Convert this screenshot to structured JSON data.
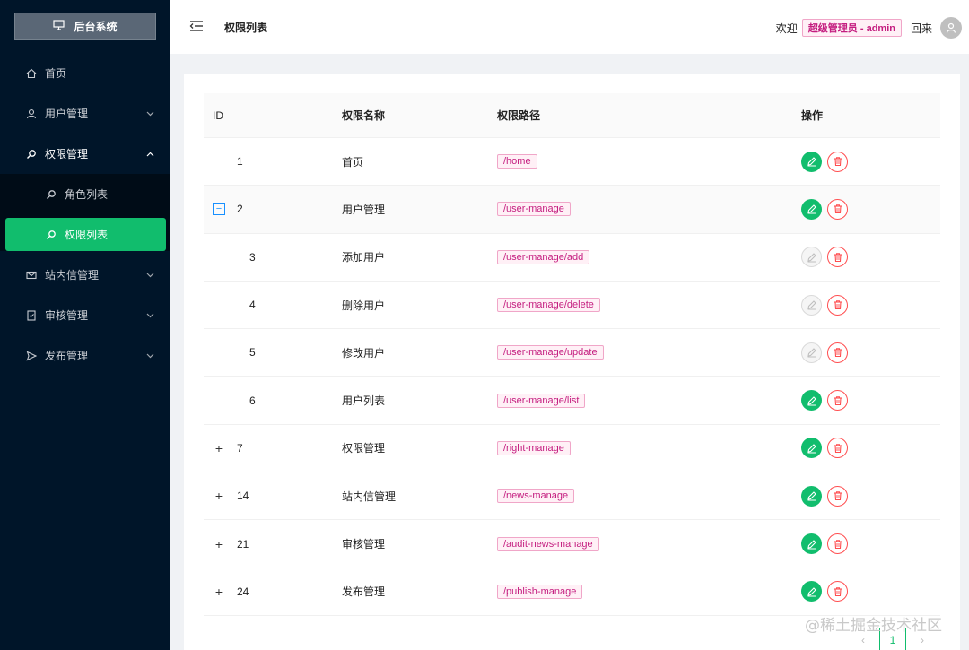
{
  "app": {
    "logo_title": "后台系统"
  },
  "sidebar": {
    "items": [
      {
        "label": "首页",
        "icon": "home-icon"
      },
      {
        "label": "用户管理",
        "icon": "user-icon"
      },
      {
        "label": "权限管理",
        "icon": "search-icon",
        "open": true,
        "children": [
          {
            "label": "角色列表",
            "icon": "search-icon"
          },
          {
            "label": "权限列表",
            "icon": "search-icon",
            "active": true
          }
        ]
      },
      {
        "label": "站内信管理",
        "icon": "mail-icon"
      },
      {
        "label": "审核管理",
        "icon": "audit-icon"
      },
      {
        "label": "发布管理",
        "icon": "send-icon"
      }
    ]
  },
  "header": {
    "title": "权限列表",
    "welcome": "欢迎",
    "role": "超级管理员 - admin",
    "back": "回来"
  },
  "table": {
    "columns": [
      "ID",
      "权限名称",
      "权限路径",
      "操作"
    ],
    "rows": [
      {
        "id": "1",
        "name": "首页",
        "path": "/home",
        "expander": "",
        "child": false,
        "edit_disabled": false
      },
      {
        "id": "2",
        "name": "用户管理",
        "path": "/user-manage",
        "expander": "minus",
        "child": false,
        "edit_disabled": false
      },
      {
        "id": "3",
        "name": "添加用户",
        "path": "/user-manage/add",
        "expander": "",
        "child": true,
        "edit_disabled": true
      },
      {
        "id": "4",
        "name": "删除用户",
        "path": "/user-manage/delete",
        "expander": "",
        "child": true,
        "edit_disabled": true
      },
      {
        "id": "5",
        "name": "修改用户",
        "path": "/user-manage/update",
        "expander": "",
        "child": true,
        "edit_disabled": true
      },
      {
        "id": "6",
        "name": "用户列表",
        "path": "/user-manage/list",
        "expander": "",
        "child": true,
        "edit_disabled": false
      },
      {
        "id": "7",
        "name": "权限管理",
        "path": "/right-manage",
        "expander": "plus",
        "child": false,
        "edit_disabled": false
      },
      {
        "id": "14",
        "name": "站内信管理",
        "path": "/news-manage",
        "expander": "plus",
        "child": false,
        "edit_disabled": false
      },
      {
        "id": "21",
        "name": "审核管理",
        "path": "/audit-news-manage",
        "expander": "plus",
        "child": false,
        "edit_disabled": false
      },
      {
        "id": "24",
        "name": "发布管理",
        "path": "/publish-manage",
        "expander": "plus",
        "child": false,
        "edit_disabled": false
      }
    ]
  },
  "pagination": {
    "prev": "‹",
    "current": "1",
    "next": "›"
  },
  "watermark": "@稀土掘金技术社区",
  "colors": {
    "sidebar_bg": "#001529",
    "accent": "#11bd6d",
    "danger": "#ff4d4f",
    "tag": "#c41d7f"
  }
}
